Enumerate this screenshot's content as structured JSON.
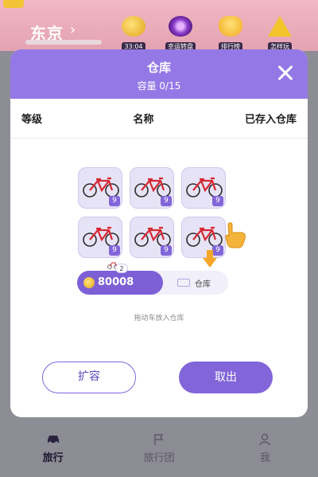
{
  "background": {
    "city": "东京",
    "icons": [
      {
        "label": "33:04",
        "icon": "coin-timer-icon"
      },
      {
        "label": "幸运转盘",
        "icon": "wheel-icon"
      },
      {
        "label": "排行榜",
        "icon": "trophy-icon"
      },
      {
        "label": "怎样玩",
        "icon": "warning-icon"
      }
    ]
  },
  "modal": {
    "title": "仓库",
    "capacity": "容量 0/15",
    "columns": [
      "等级",
      "名称",
      "已存入仓库"
    ],
    "items": [
      {
        "level": "9"
      },
      {
        "level": "9"
      },
      {
        "level": "9"
      },
      {
        "level": "9"
      },
      {
        "level": "9"
      },
      {
        "level": "9"
      }
    ],
    "coins": "80008",
    "coin_badge": "2",
    "warehouse_label": "仓库",
    "hint": "拖动车放入仓库",
    "expand_button": "扩容",
    "take_out_button": "取出"
  },
  "nav": {
    "items": [
      {
        "label": "旅行",
        "icon": "car-icon"
      },
      {
        "label": "旅行团",
        "icon": "flag-icon"
      },
      {
        "label": "我",
        "icon": "user-icon"
      }
    ]
  },
  "colors": {
    "accent": "#8265d9",
    "header": "#9479e6",
    "cell_bg": "#e7e3f6"
  }
}
